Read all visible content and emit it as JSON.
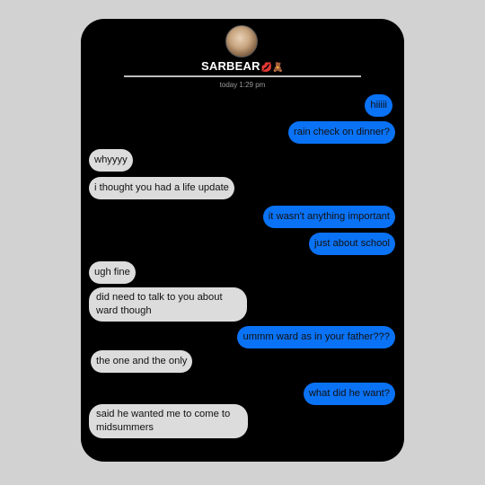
{
  "contact": {
    "name": "SARBEAR",
    "emoji": "💋🧸"
  },
  "timestamp": "today 1:29 pm",
  "messages": [
    {
      "dir": "sent",
      "text": "hiiiii"
    },
    {
      "dir": "sent",
      "text": "rain check on dinner?"
    },
    {
      "dir": "received",
      "text": "whyyyy"
    },
    {
      "dir": "received",
      "text": "i thought you had a life update"
    },
    {
      "dir": "sent",
      "text": "it wasn't anything important"
    },
    {
      "dir": "sent",
      "text": "just about school"
    },
    {
      "dir": "received",
      "text": "ugh fine"
    },
    {
      "dir": "received",
      "text": "did need to talk to you about ward though"
    },
    {
      "dir": "sent",
      "text": "ummm ward as in your father???"
    },
    {
      "dir": "received",
      "text": "the one and the only"
    },
    {
      "dir": "sent",
      "text": "what did he want?"
    },
    {
      "dir": "received",
      "text": "said he wanted me to come to midsummers"
    }
  ],
  "colors": {
    "sent_bubble": "#0a72f5",
    "received_bubble": "#dcdcdc",
    "background": "#000000"
  }
}
